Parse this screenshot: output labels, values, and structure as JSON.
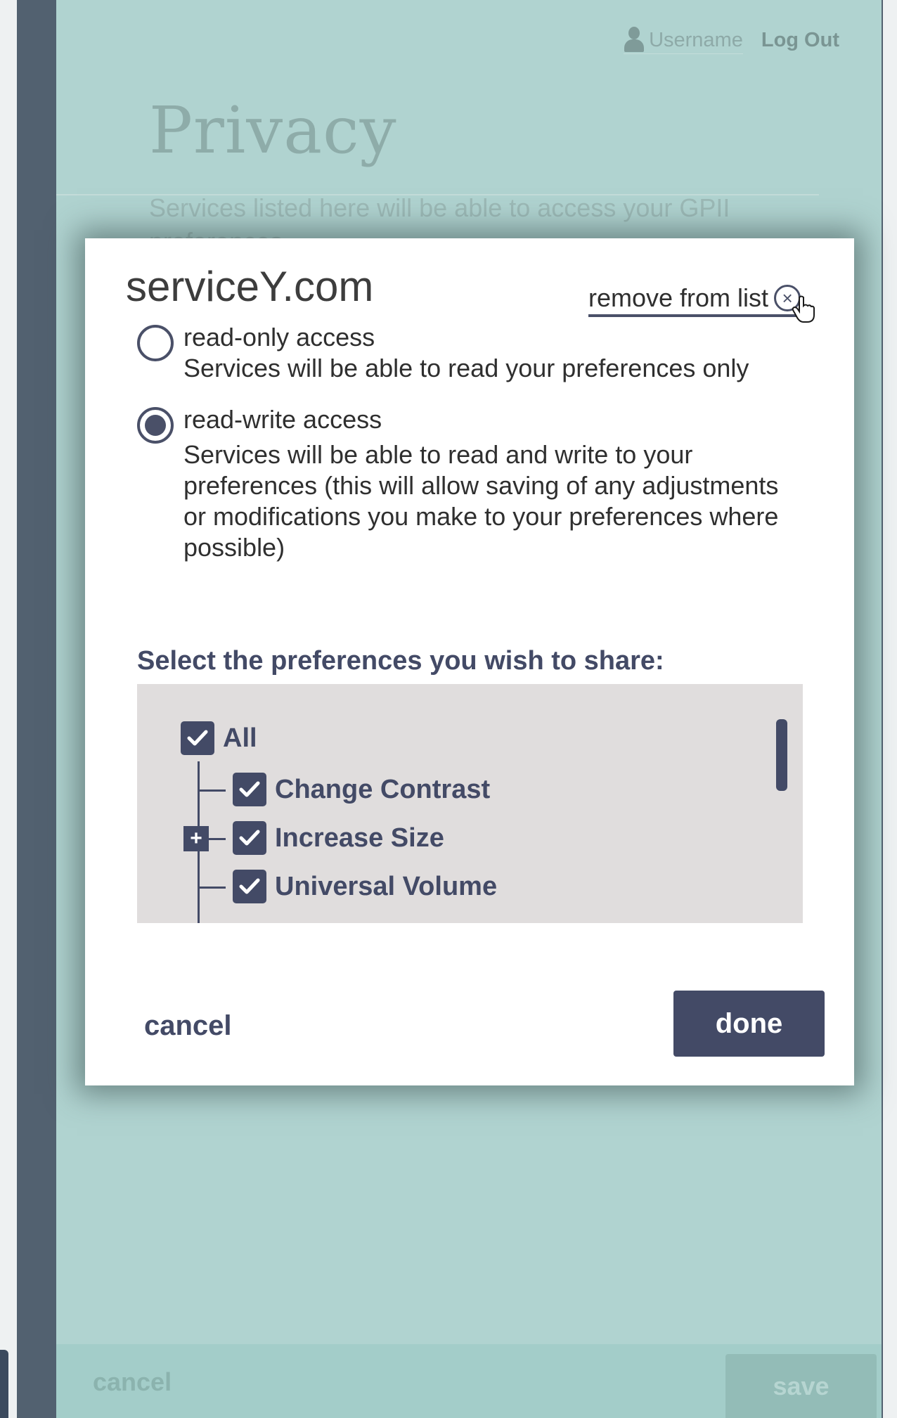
{
  "header": {
    "username_label": "Username",
    "logout_label": "Log Out"
  },
  "page": {
    "title": "Privacy",
    "description": "Services listed here will be able to access your GPII preferences."
  },
  "footer": {
    "cancel_label": "cancel",
    "save_label": "save"
  },
  "modal": {
    "title": "serviceY.com",
    "remove_label": "remove from list",
    "access_options": [
      {
        "label": "read-only access",
        "description": "Services will be able to read your preferences only",
        "selected": false
      },
      {
        "label": "read-write access",
        "description": "Services will be able to read and write to your preferences (this will allow saving of any adjustments or modifications you make to your preferences where possible)",
        "selected": true
      }
    ],
    "share_label": "Select the preferences you wish to share:",
    "preferences": [
      {
        "label": "All",
        "checked": true
      },
      {
        "label": "Change Contrast",
        "checked": true
      },
      {
        "label": "Increase Size",
        "checked": true
      },
      {
        "label": "Universal Volume",
        "checked": true
      }
    ],
    "cancel_label": "cancel",
    "done_label": "done"
  },
  "colors": {
    "page_bg": "#b0d3d0",
    "frame": "#526170",
    "accent": "#434a66",
    "tree_bg": "#e0dddd"
  }
}
